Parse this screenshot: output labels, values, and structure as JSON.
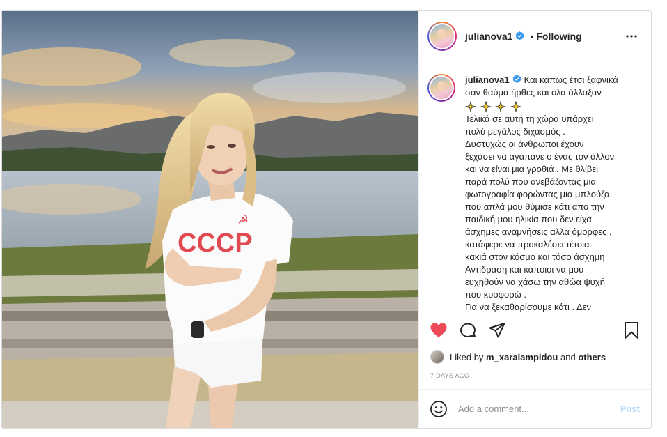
{
  "header": {
    "username": "julianova1",
    "separator": "•",
    "following_label": "Following",
    "more_icon": "more-horizontal-icon"
  },
  "caption": {
    "username": "julianova1",
    "lines": [
      "Και κάπως έτσι ξαφνικά",
      "σαν θαύμα ήρθες και όλα άλλαξαν",
      "Τελικά σε αυτή τη χώρα υπάρχει",
      "πολύ μεγάλος διχασμός .",
      "Δυστυχώς οι άνθρωποι έχουν",
      "ξεχάσει να αγαπάνε ο ένας τον άλλον",
      "και να είναι μια γροθιά . Με θλίβει",
      "παρά πολύ που ανεβάζοντας μια",
      "φωτογραφία φορώντας μια μπλούζα",
      "που απλά μου θύμισε κάτι απο την",
      "παιδική μου ηλικία που δεν είχα",
      "άσχημες αναμνήσεις αλλα όμορφες ,",
      "κατάφερε να προκαλέσει τέτοια",
      "κακιά στον κόσμο και τόσο άσχημη",
      "Αντίδραση και κάποιοι να μου",
      "ευχηθούν να χάσω την αθώα ψυχή",
      "που κυοφορώ .",
      "Για να ξεκαθαρίσουμε κάτι . Δεν"
    ],
    "emoji_icon": "sparkles-icon"
  },
  "photo": {
    "shirt_text": "СССР"
  },
  "actions": {
    "like_icon": "heart-filled-icon",
    "comment_icon": "comment-icon",
    "share_icon": "paper-plane-icon",
    "save_icon": "bookmark-icon"
  },
  "likes": {
    "prefix": "Liked by",
    "user": "m_xaralampidou",
    "joiner": "and",
    "others": "others"
  },
  "timestamp": "7 DAYS AGO",
  "add_comment": {
    "placeholder": "Add a comment...",
    "post_label": "Post"
  },
  "colors": {
    "heart": "#ed4956",
    "verified": "#3897f0",
    "post_disabled": "#b3dbff",
    "muted": "#8e8e8e"
  }
}
